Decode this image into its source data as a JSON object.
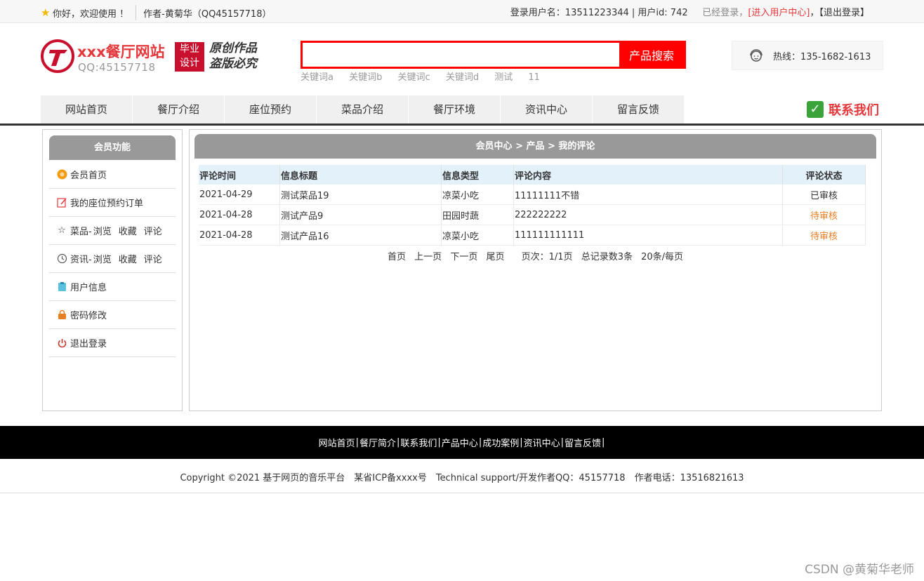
{
  "topbar": {
    "greeting": "你好，欢迎使用 ！",
    "author": "作者-黄菊华（QQ45157718）",
    "login_info": "登录用户名：13511223344 | 用户id: 742",
    "logged_status": "已经登录，",
    "enter_center": "[进入用户中心]",
    "comma": "，",
    "logout": "【退出登录】"
  },
  "header": {
    "site_title": "xxx餐厅网站",
    "site_qq": "QQ:45157718",
    "badge_line1": "毕业",
    "badge_line2": "设计",
    "slogan_line1": "原创作品",
    "slogan_line2": "盗版必究",
    "search_placeholder": "",
    "search_button": "产品搜索",
    "keywords": [
      "关键词a",
      "关键词b",
      "关键词c",
      "关键词d",
      "测试",
      "11"
    ],
    "hotline": "热线：135-1682-1613"
  },
  "nav": {
    "items": [
      "网站首页",
      "餐厅介绍",
      "座位预约",
      "菜品介绍",
      "餐厅环境",
      "资讯中心",
      "留言反馈"
    ],
    "contact": "联系我们"
  },
  "sidebar": {
    "title": "会员功能",
    "items": {
      "home": "会员首页",
      "orders": "我的座位预约订单",
      "dish": "菜品-",
      "news": "资讯-",
      "browse": "浏览",
      "fav": "收藏",
      "comment": "评论",
      "userinfo": "用户信息",
      "password": "密码修改",
      "logout": "退出登录"
    }
  },
  "main": {
    "breadcrumb": "会员中心 > 产品 > 我的评论",
    "columns": [
      "评论时间",
      "信息标题",
      "信息类型",
      "评论内容",
      "评论状态"
    ],
    "rows": [
      {
        "time": "2021-04-29",
        "title": "测试菜品19",
        "type": "凉菜小吃",
        "content": "11111111不错",
        "status": "已审核"
      },
      {
        "time": "2021-04-28",
        "title": "测试产品9",
        "type": "田园时蔬",
        "content": "222222222",
        "status": "待审核"
      },
      {
        "time": "2021-04-28",
        "title": "测试产品16",
        "type": "凉菜小吃",
        "content": "111111111111",
        "status": "待审核"
      }
    ],
    "pager": {
      "first": "首页",
      "prev": "上一页",
      "next": "下一页",
      "last": "尾页",
      "page_info": "页次：1/1页",
      "total": "总记录数3条",
      "per_page": "20条/每页"
    }
  },
  "footer": {
    "links": [
      "网站首页",
      "餐厅简介",
      "联系我们",
      "产品中心",
      "成功案例",
      "资讯中心",
      "留言反馈"
    ],
    "separator": "|",
    "copyright": "Copyright ©2021 基于网页的音乐平台　某省ICP备xxxx号　Technical support/开发作者QQ：45157718　作者电话：13516821613"
  },
  "watermark": "CSDN @黄菊华老师",
  "colors": {
    "accent_red": "#ff0000",
    "brand_red": "#e4393c",
    "pending_orange": "#e67e22",
    "header_gray": "#999999",
    "table_head_blue": "#e3f1fb"
  }
}
